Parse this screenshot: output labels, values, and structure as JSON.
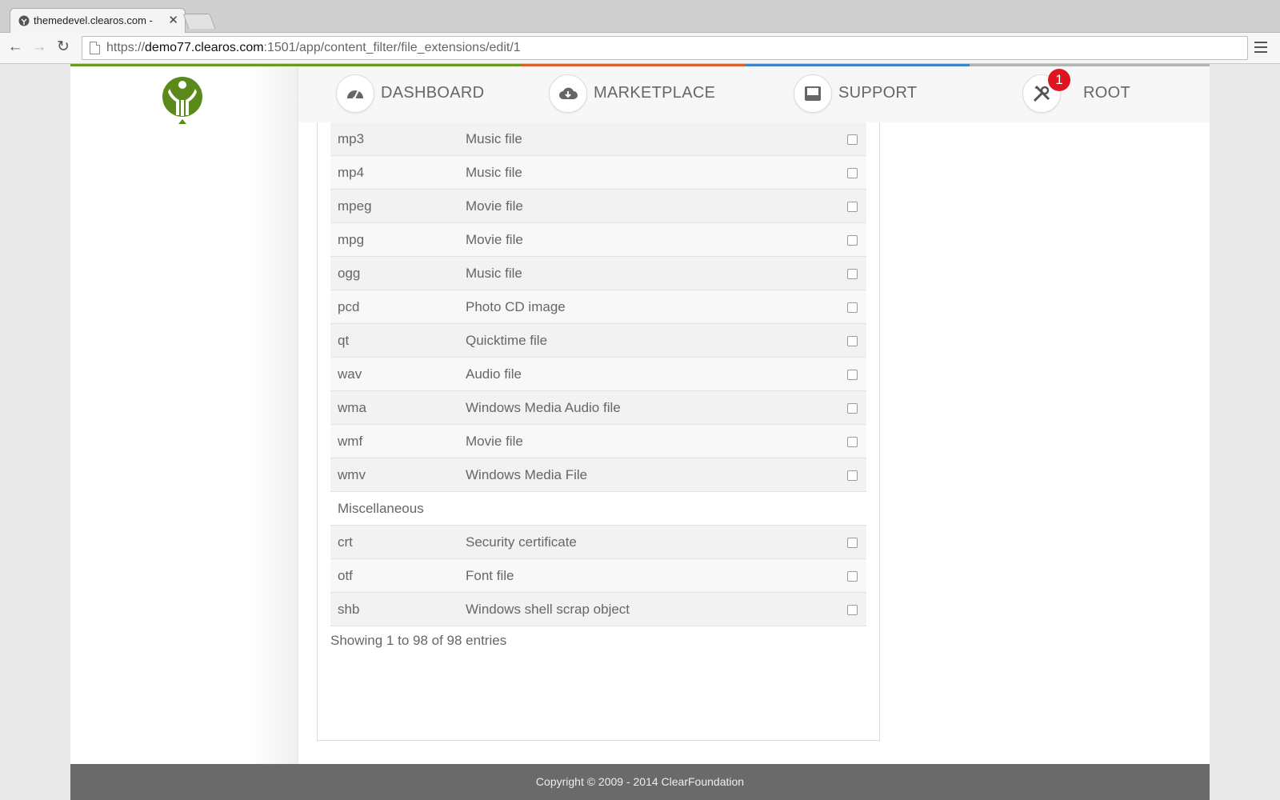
{
  "browser": {
    "tab_title": "themedevel.clearos.com -",
    "url_scheme": "https://",
    "url_host": "demo77.clearos.com",
    "url_rest": ":1501/app/content_filter/file_extensions/edit/1"
  },
  "topnav": {
    "items": [
      {
        "label": "DASHBOARD",
        "icon": "dashboard-gauge-icon"
      },
      {
        "label": "MARKETPLACE",
        "icon": "cloud-download-icon"
      },
      {
        "label": "SUPPORT",
        "icon": "inbox-tray-icon"
      },
      {
        "label": "ROOT",
        "icon": "tools-icon",
        "badge": "1"
      }
    ],
    "accent_colors": [
      "#6a9a1f",
      "#d9632a",
      "#3a86c8",
      "#a8a8a8"
    ]
  },
  "extensions": {
    "rows": [
      {
        "type": "row",
        "ext": "mp3",
        "desc": "Music file"
      },
      {
        "type": "row",
        "ext": "mp4",
        "desc": "Music file"
      },
      {
        "type": "row",
        "ext": "mpeg",
        "desc": "Movie file"
      },
      {
        "type": "row",
        "ext": "mpg",
        "desc": "Movie file"
      },
      {
        "type": "row",
        "ext": "ogg",
        "desc": "Music file"
      },
      {
        "type": "row",
        "ext": "pcd",
        "desc": "Photo CD image"
      },
      {
        "type": "row",
        "ext": "qt",
        "desc": "Quicktime file"
      },
      {
        "type": "row",
        "ext": "wav",
        "desc": "Audio file"
      },
      {
        "type": "row",
        "ext": "wma",
        "desc": "Windows Media Audio file"
      },
      {
        "type": "row",
        "ext": "wmf",
        "desc": "Movie file"
      },
      {
        "type": "row",
        "ext": "wmv",
        "desc": "Windows Media File"
      },
      {
        "type": "group",
        "ext": "Miscellaneous"
      },
      {
        "type": "row",
        "ext": "crt",
        "desc": "Security certificate"
      },
      {
        "type": "row",
        "ext": "otf",
        "desc": "Font file"
      },
      {
        "type": "row",
        "ext": "shb",
        "desc": "Windows shell scrap object"
      }
    ],
    "showing": "Showing 1 to 98 of 98 entries"
  },
  "footer": {
    "text": "Copyright © 2009 - 2014 ClearFoundation"
  },
  "colors": {
    "brand_green": "#5a8a1c",
    "badge_red": "#e0141e"
  }
}
